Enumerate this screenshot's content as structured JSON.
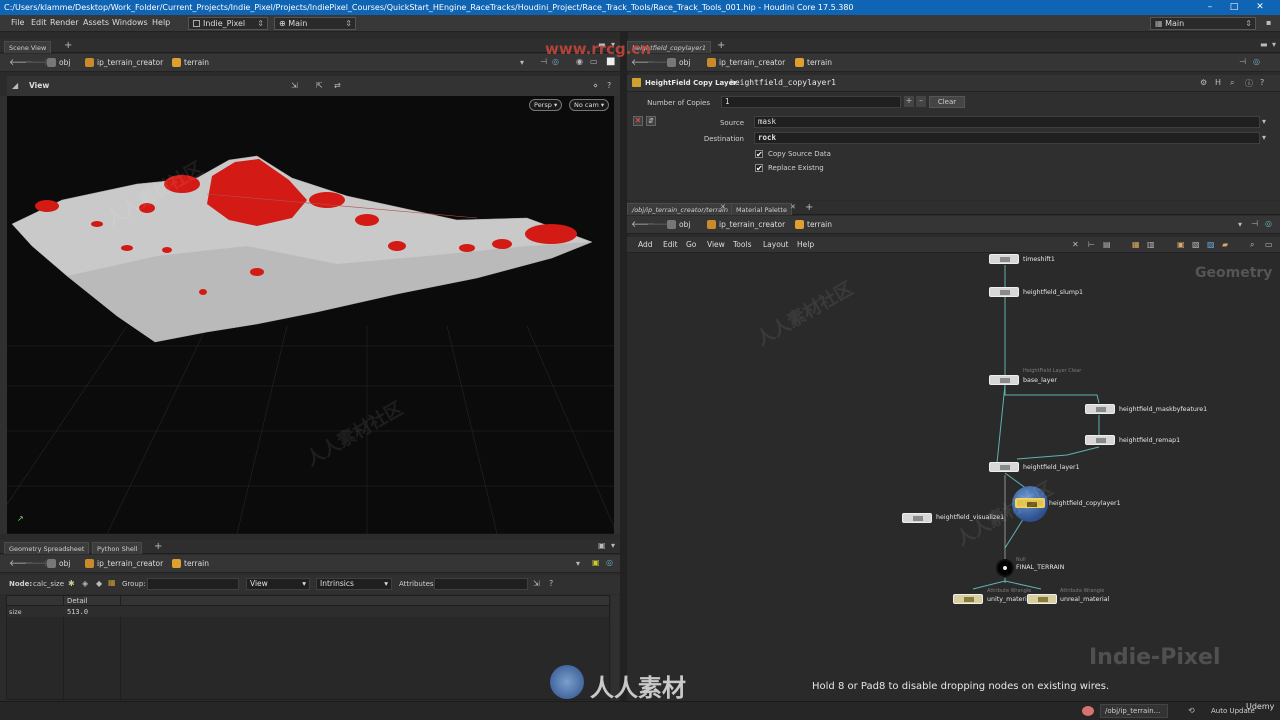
{
  "window": {
    "title": "C:/Users/klamme/Desktop/Work_Folder/Current_Projects/Indie_Pixel/Projects/IndiePixel_Courses/QuickStart_HEngine_RaceTracks/Houdini_Project/Race_Track_Tools/Race_Track_Tools_001.hip - Houdini Core 17.5.380",
    "minimize": "–",
    "maximize": "□",
    "close": "✕"
  },
  "menubar": {
    "items": [
      "File",
      "Edit",
      "Render",
      "Assets",
      "Windows",
      "Help"
    ],
    "desktop": "Indie_Pixel",
    "context": "Main",
    "right_desktop": "Main"
  },
  "scene": {
    "tab": "Scene View",
    "path": [
      "obj",
      "ip_terrain_creator",
      "terrain"
    ],
    "view_label": "View",
    "persp": "Persp ▾",
    "cam": "No cam ▾"
  },
  "params": {
    "tab": "heightfield_copylayer1",
    "path": [
      "obj",
      "ip_terrain_creator",
      "terrain"
    ],
    "node_type": "HeightField Copy Layer",
    "node_name": "heightfield_copylayer1",
    "copies_label": "Number of Copies",
    "copies_value": "1",
    "plus": "+",
    "minus": "–",
    "clear": "Clear",
    "source_label": "Source",
    "source_value": "mask",
    "dest_label": "Destination",
    "dest_value": "rock",
    "copy_source": "Copy Source Data",
    "replace_existing": "Replace Existng",
    "remove_btn": "✕"
  },
  "network": {
    "tabs": [
      "/obj/ip_terrain_creator/terrain",
      "Material Palette"
    ],
    "path": [
      "obj",
      "ip_terrain_creator",
      "terrain"
    ],
    "menu": [
      "Add",
      "Edit",
      "Go",
      "View",
      "Tools",
      "Layout",
      "Help"
    ],
    "context_label": "Geometry",
    "hint": "Hold 8 or Pad8 to disable dropping nodes on existing wires.",
    "nodes": [
      {
        "name": "timeshift1",
        "sub": ""
      },
      {
        "name": "heightfield_slump1",
        "sub": ""
      },
      {
        "name": "base_layer",
        "sub": "HeightField Layer Clear"
      },
      {
        "name": "heightfield_maskbyfeature1",
        "sub": ""
      },
      {
        "name": "heightfield_remap1",
        "sub": ""
      },
      {
        "name": "heightfield_layer1",
        "sub": ""
      },
      {
        "name": "heightfield_copylayer1",
        "sub": ""
      },
      {
        "name": "heightfield_visualize1",
        "sub": ""
      },
      {
        "name": "FINAL_TERRAIN",
        "sub": "Null"
      },
      {
        "name": "unity_material",
        "sub": "Attribute Wrangle"
      },
      {
        "name": "unreal_material",
        "sub": "Attribute Wrangle"
      }
    ]
  },
  "spreadsheet": {
    "tabs": [
      "Geometry Spreadsheet",
      "Python Shell"
    ],
    "path": [
      "obj",
      "ip_terrain_creator",
      "terrain"
    ],
    "node_label": "Node:",
    "node_value": "calc_size",
    "group_label": "Group:",
    "view": "View",
    "intrinsics": "Intrinsics",
    "attributes_label": "Attributes:",
    "col_header": "Detail",
    "row_name": "size",
    "row_value": "513.0"
  },
  "statusbar": {
    "path": "/obj/ip_terrain...",
    "auto_update": "Auto Update",
    "udemy": "Udemy"
  },
  "watermark": {
    "site": "www.rrcg.cn",
    "logo_text": "人人素材",
    "brand": "Indie-Pixel",
    "tile_text": "人人素材社区"
  }
}
